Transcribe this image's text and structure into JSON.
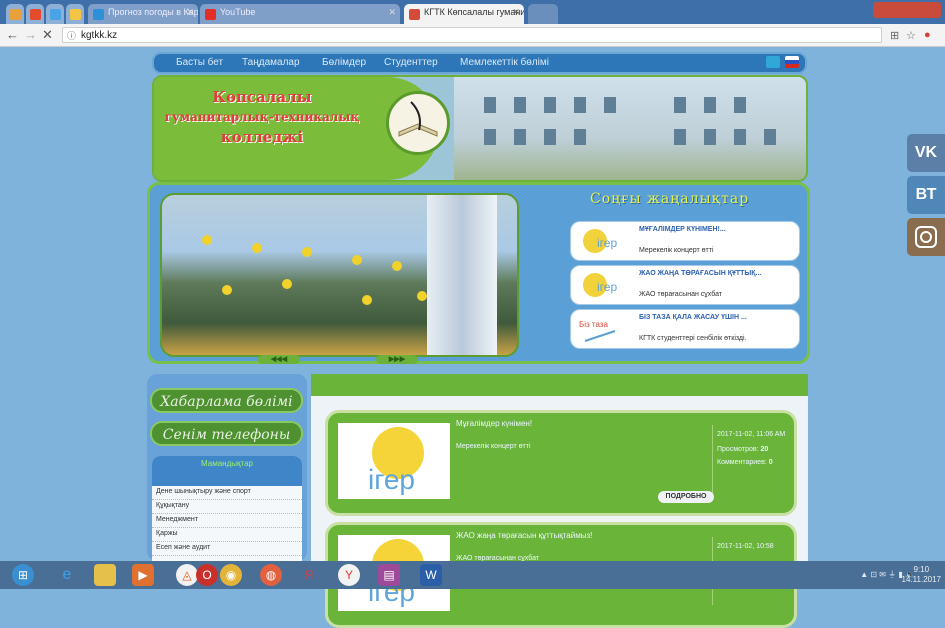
{
  "browser": {
    "tabs": [
      {
        "label": "",
        "color": "#e9a23b"
      },
      {
        "label": "",
        "color": "#e34b2c"
      },
      {
        "label": "",
        "color": "#4aa3e6"
      },
      {
        "label": "",
        "color": "#f4c542"
      },
      {
        "label": "Прогноз погоды в Каре",
        "color": "#2f8fd8"
      },
      {
        "label": "YouTube",
        "color": "#e52d27"
      },
      {
        "label": "КГТК Көпсалалы гумани",
        "color": "#d64a3a"
      }
    ],
    "url": "kgtkk.kz"
  },
  "site": {
    "nav": [
      "Басты бет",
      "Таңдамалар",
      "Бөлімдер",
      "Студенттер",
      "Мемлекеттік бөлімі"
    ],
    "college_name": [
      "Көпсалалы",
      "гуманитарлық-техникалық",
      "колледжі"
    ],
    "slider": {
      "prev": "◀◀◀",
      "next": "▶▶▶"
    },
    "latest_news_title": "Соңғы жаңалықтар",
    "news": [
      {
        "title": "МҰҒАЛІМДЕР КҮНІМЕН!...",
        "desc": "Мерекелік концерт өтті"
      },
      {
        "title": "ЖАО ЖАҢА ТӨРАҒАСЫН ҚҰТТЫҚ...",
        "desc": "ЖАО төрағасынан сұхбат"
      },
      {
        "title": "БІЗ ТАЗА ҚАЛА ЖАСАУ ҮШІН ...",
        "desc": "КГТК студенттері сенбілік өткізді."
      }
    ],
    "sidebar": {
      "btn_announcements": "Хабарлама бөлімі",
      "btn_hotline": "Сенім телефоны",
      "specialties_header": "Мамандықтар",
      "specialties": [
        "Дене шынықтыру және спорт",
        "Құқықтану",
        "Менеджмент",
        "Қаржы",
        "Есеп және аудит"
      ]
    },
    "cards": [
      {
        "title": "Мұғалімдер күнімен!",
        "desc": "Мерекелік концерт өтті",
        "date": "2017-11-02, 11:06 AM",
        "views_label": "Просмотров:",
        "views": "20",
        "comments_label": "Комментариев:",
        "comments": "0",
        "more": "ПОДРОБНО",
        "logo_text": "ігер"
      },
      {
        "title": "ЖАО жаңа төрағасын құттықтаймыз!",
        "desc": "ЖАО төрағасынан сұхбат",
        "date": "2017-11-02, 10:58",
        "logo_text": "ігер"
      }
    ],
    "social": [
      {
        "label": "VK",
        "color": "#5b7fa6"
      },
      {
        "label": "ВТ",
        "color": "#4f87b9"
      },
      {
        "label": "",
        "color": "#8a6d4f"
      }
    ]
  },
  "taskbar": {
    "clock_time": "9:10",
    "clock_date": "14.11.2017"
  }
}
